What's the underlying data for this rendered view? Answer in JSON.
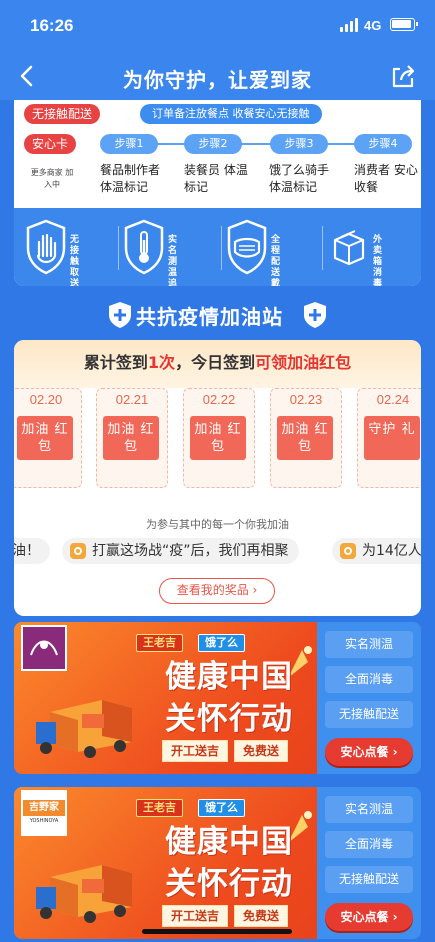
{
  "status_bar": {
    "time": "16:26",
    "network": "4G"
  },
  "header": {
    "title": "为你守护，让爱到家"
  },
  "safety_card": {
    "contactless_tag": "无接触配送",
    "note": "订单备注放餐点 收餐安心无接触",
    "safe_card_tag": "安心卡",
    "more_merchants": "更多商家 加入中",
    "steps": [
      {
        "label": "步骤1",
        "desc": "餐品制作者 体温标记"
      },
      {
        "label": "步骤2",
        "desc": "装餐员 体温标记"
      },
      {
        "label": "步骤3",
        "desc": "饿了么骑手 体温标记"
      },
      {
        "label": "步骤4",
        "desc": "消费者 安心收餐"
      }
    ],
    "features": [
      {
        "icon": "hand-icon",
        "label": "无接触 取送餐"
      },
      {
        "icon": "thermometer-icon",
        "label": "实名 测温追踪"
      },
      {
        "icon": "mask-icon",
        "label": "全程配送 戴口罩"
      },
      {
        "icon": "package-icon",
        "label": "外卖箱 消毒"
      }
    ]
  },
  "section": {
    "title": "共抗疫情加油站"
  },
  "checkin": {
    "prefix": "累计签到",
    "count": "1次",
    "middle": "，今日签到",
    "reward": "可领加油红包",
    "days": [
      {
        "date": "02.20",
        "label": "加油 红包"
      },
      {
        "date": "02.21",
        "label": "加油 红包"
      },
      {
        "date": "02.22",
        "label": "加油 红包"
      },
      {
        "date": "02.23",
        "label": "加油 红包"
      },
      {
        "date": "02.24",
        "label": "守护 礼"
      }
    ],
    "cheer_label": "为参与其中的每一个你我加油",
    "messages": [
      "油！",
      "打赢这场战“疫”后，我们再相聚",
      "为14亿人"
    ],
    "prize_button": "查看我的奖品 ›"
  },
  "ads": [
    {
      "brand_tags": [
        "王老吉",
        "饿了么"
      ],
      "slogan": "健康中国 关怀行动",
      "chips": [
        "开工送吉",
        "免费送"
      ],
      "side_buttons": [
        "实名测温",
        "全面消毒",
        "无接触配送"
      ],
      "cta": "安心点餐 ›"
    },
    {
      "brand_tags": [
        "王老吉",
        "饿了么"
      ],
      "logo_text": "吉野家",
      "logo_subtext": "YOSHINOYA",
      "slogan": "健康中国 关怀行动",
      "chips": [
        "开工送吉",
        "免费送"
      ],
      "side_buttons": [
        "实名测温",
        "全面消毒",
        "无接触配送"
      ],
      "cta": "安心点餐 ›"
    }
  ],
  "colors": {
    "primary_blue": "#3a86ee",
    "accent_red": "#e8342e",
    "orange": "#f28a2e"
  }
}
